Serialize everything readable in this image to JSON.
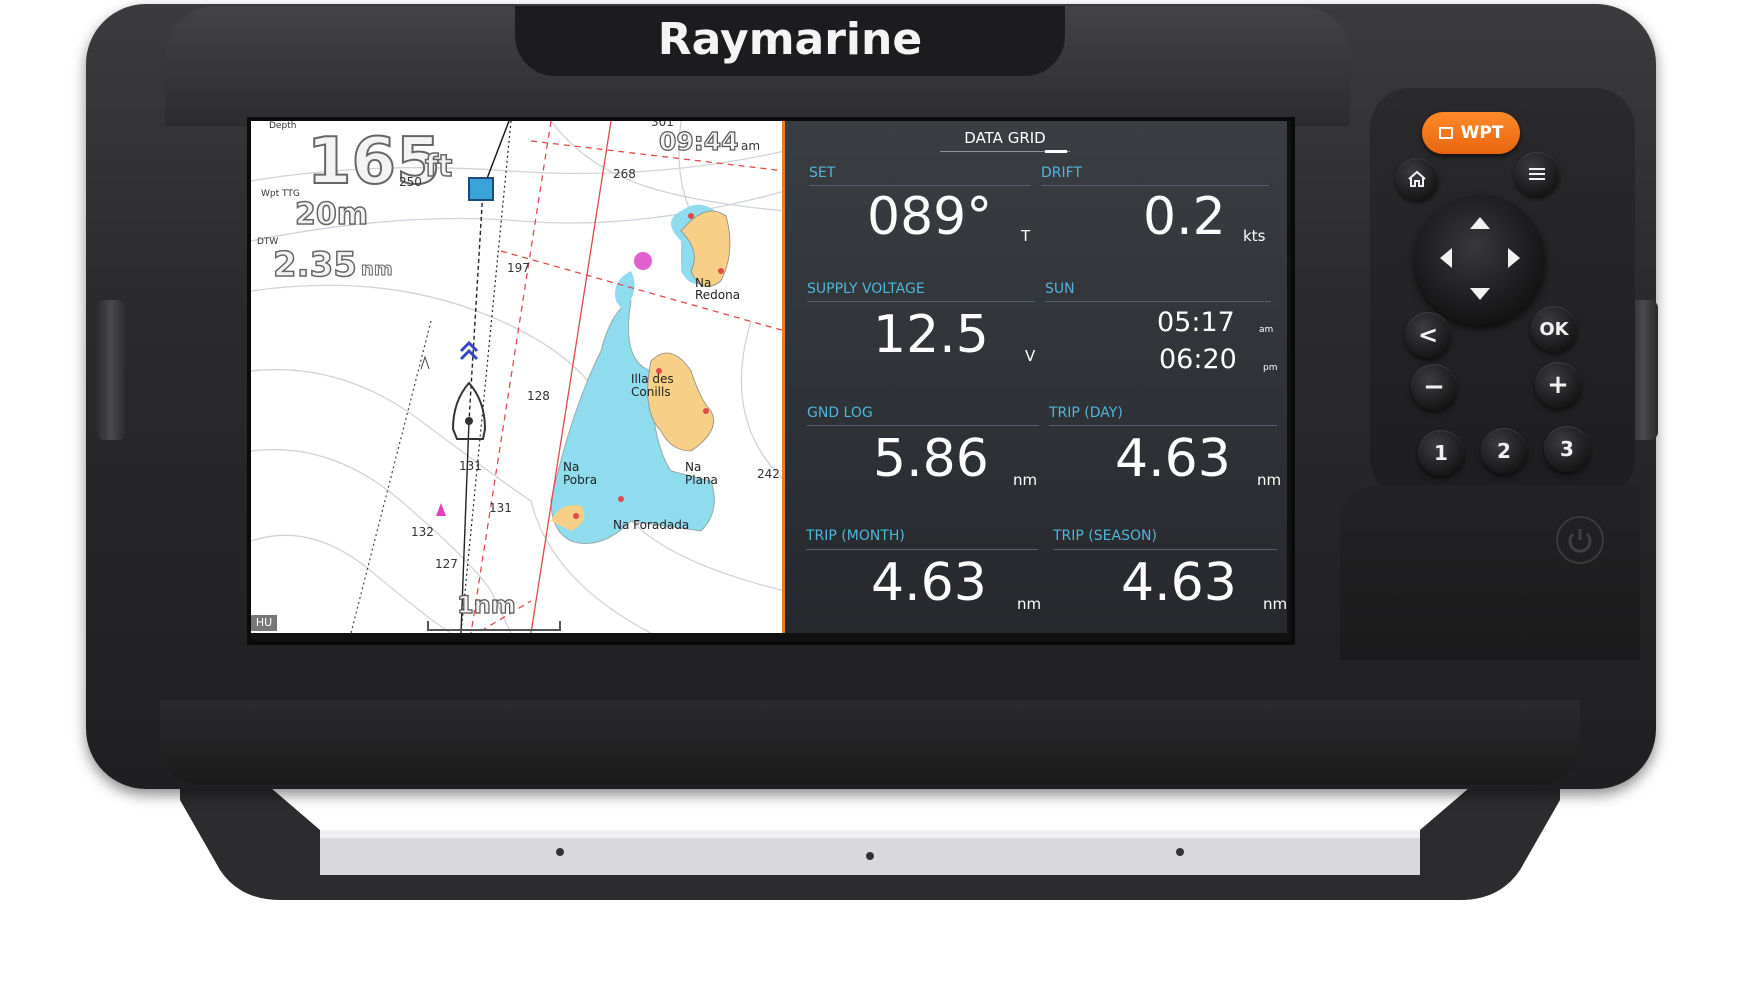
{
  "brand": "Raymarine",
  "chart": {
    "depth_label": "Depth",
    "depth_value": "165",
    "depth_unit": "ft",
    "wpt_ttg_label": "Wpt TTG",
    "wpt_ttg_value": "20m",
    "dtw_label": "DTW",
    "dtw_value": "2.35",
    "dtw_unit": "nm",
    "time_value": "09:44",
    "time_suffix": "am",
    "scale_label": "1nm",
    "orientation": "HU",
    "soundings": [
      "301",
      "268",
      "250",
      "197",
      "128",
      "131",
      "131",
      "132",
      "127",
      "242"
    ],
    "place_names": [
      "Na Redona",
      "Illa des Conills",
      "Na Pobra",
      "Na Plana",
      "Na Foradada"
    ],
    "colors": {
      "land": "#f7cf86",
      "shallow": "#8fdcee",
      "route": "#3346c7",
      "limit": "#e24a4a"
    }
  },
  "data_grid": {
    "title": "DATA GRID",
    "cells": [
      {
        "label": "SET",
        "value": "089°",
        "unit": "T"
      },
      {
        "label": "DRIFT",
        "value": "0.2",
        "unit": "kts"
      },
      {
        "label": "SUPPLY VOLTAGE",
        "value": "12.5",
        "unit": "V"
      },
      {
        "label": "SUN",
        "rise": "05:17",
        "rise_suffix": "am",
        "set": "06:20",
        "set_suffix": "pm"
      },
      {
        "label": "GND LOG",
        "value": "5.86",
        "unit": "nm"
      },
      {
        "label": "TRIP (DAY)",
        "value": "4.63",
        "unit": "nm"
      },
      {
        "label": "TRIP (MONTH)",
        "value": "4.63",
        "unit": "nm"
      },
      {
        "label": "TRIP (SEASON)",
        "value": "4.63",
        "unit": "nm"
      }
    ]
  },
  "keypad": {
    "wpt_label": "WPT",
    "home_icon": "home-icon",
    "menu_icon": "menu-icon",
    "back_label": "<",
    "ok_label": "OK",
    "minus_label": "−",
    "plus_label": "+",
    "numbers": [
      "1",
      "2",
      "3"
    ],
    "accent_color": "#f27a1a"
  }
}
